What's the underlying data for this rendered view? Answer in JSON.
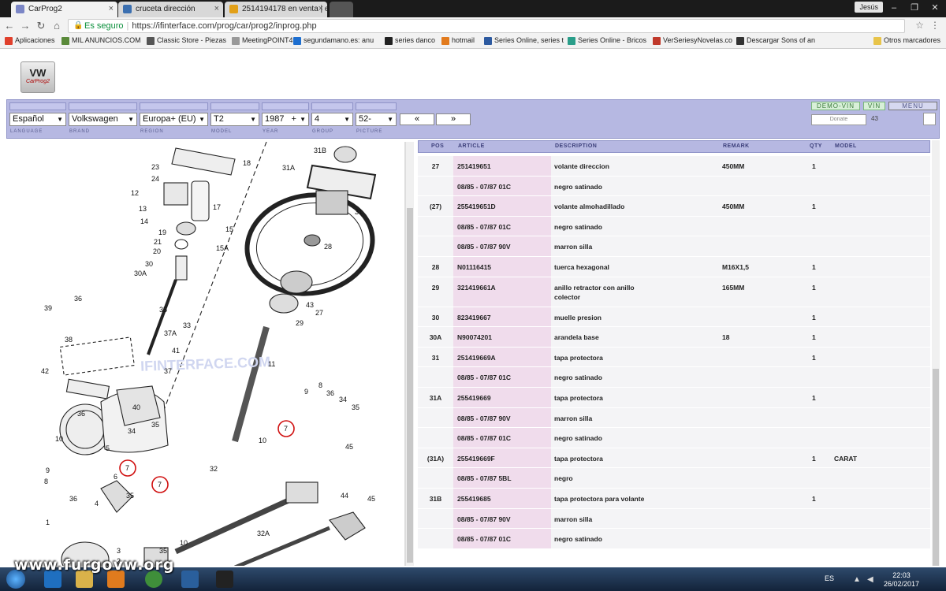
{
  "browser": {
    "tabs": [
      {
        "title": "CarProg2"
      },
      {
        "title": "cruceta dirección"
      },
      {
        "title": "2514194178 en venta | e"
      }
    ],
    "user": "Jesús",
    "secure_label": "Es seguro",
    "url": "https://ifinterface.com/prog/car/prog2/inprog.php",
    "bookmarks": [
      {
        "label": "Aplicaciones",
        "color": "#e0402c"
      },
      {
        "label": "MIL ANUNCIOS.COM",
        "color": "#5a8a3a"
      },
      {
        "label": "Classic Store - Piezas",
        "color": "#555"
      },
      {
        "label": "MeetingPOINT4u",
        "color": "#999"
      },
      {
        "label": "segundamano.es: anu",
        "color": "#1e6fd0"
      },
      {
        "label": "series danco",
        "color": "#222"
      },
      {
        "label": "hotmail",
        "color": "#e27b1e"
      },
      {
        "label": "Series Online, series t",
        "color": "#2d5aa0"
      },
      {
        "label": "Series Online - Bricos",
        "color": "#2a9e8a"
      },
      {
        "label": "VerSeriesyNovelas.co",
        "color": "#c0392b"
      },
      {
        "label": "Descargar Sons of an",
        "color": "#333"
      },
      {
        "label": "Otros marcadores",
        "color": "#e8c44a"
      }
    ]
  },
  "logo": {
    "brand": "VW",
    "sub": "CarProg2"
  },
  "selectors": {
    "language": "Español",
    "brand": "Volkswagen",
    "region": "Europa+ (EU)",
    "model": "T2",
    "year": "1987",
    "year_plus": "+",
    "group": "4",
    "picture": "52-",
    "prev": "«",
    "next": "»",
    "labels": [
      "LANGUAGE",
      "BRAND",
      "REGION",
      "MODEL",
      "YEAR",
      "GROUP",
      "PICTURE"
    ],
    "demo_vin": "DEMO-VIN",
    "vin": "VIN",
    "menu": "MENU",
    "donate": "Donate",
    "count": "43"
  },
  "diagram": {
    "watermark": "IFINTERFACE.COM",
    "callouts": [
      "23",
      "24",
      "12",
      "13",
      "14",
      "19",
      "21",
      "20",
      "30",
      "30A",
      "39",
      "36",
      "35",
      "38",
      "33",
      "37A",
      "41",
      "42",
      "37",
      "40",
      "36",
      "34",
      "35",
      "10",
      "9",
      "8",
      "36",
      "4",
      "35",
      "1",
      "3",
      "2",
      "35",
      "10",
      "17",
      "18",
      "15",
      "15A",
      "31B",
      "31A",
      "31",
      "28",
      "43",
      "27",
      "29",
      "11",
      "9",
      "8",
      "36",
      "34",
      "35",
      "10",
      "45",
      "32",
      "44",
      "45",
      "32A",
      "6",
      "5"
    ],
    "circled": [
      "7",
      "7",
      "7"
    ]
  },
  "table": {
    "headers": {
      "pos": "POS",
      "article": "ARTICLE",
      "description": "DESCRIPTION",
      "remark": "REMARK",
      "qty": "QTY",
      "model": "MODEL"
    },
    "rows": [
      {
        "pos": "27",
        "article": "251419651",
        "description": "volante direccion",
        "remark": "450MM",
        "qty": "1",
        "model": ""
      },
      {
        "pos": "",
        "article": "08/85 - 07/87  01C",
        "description": "negro satinado",
        "remark": "",
        "qty": "",
        "model": ""
      },
      {
        "pos": "(27)",
        "article": "255419651D",
        "description": "volante almohadillado",
        "remark": "450MM",
        "qty": "1",
        "model": ""
      },
      {
        "pos": "",
        "article": "08/85 - 07/87  01C",
        "description": "negro satinado",
        "remark": "",
        "qty": "",
        "model": ""
      },
      {
        "pos": "",
        "article": "08/85 - 07/87  90V",
        "description": "marron silla",
        "remark": "",
        "qty": "",
        "model": ""
      },
      {
        "pos": "28",
        "article": "N01116415",
        "description": "tuerca hexagonal",
        "remark": "M16X1,5",
        "qty": "1",
        "model": ""
      },
      {
        "pos": "29",
        "article": "321419661A",
        "description": "anillo retractor con anillo",
        "description2": "colector",
        "remark": "165MM",
        "qty": "1",
        "model": ""
      },
      {
        "pos": "30",
        "article": "823419667",
        "description": "muelle presion",
        "remark": "",
        "qty": "1",
        "model": ""
      },
      {
        "pos": "30A",
        "article": "N90074201",
        "description": "arandela base",
        "remark": "18",
        "qty": "1",
        "model": ""
      },
      {
        "pos": "31",
        "article": "251419669A",
        "description": "tapa protectora",
        "remark": "",
        "qty": "1",
        "model": ""
      },
      {
        "pos": "",
        "article": "08/85 - 07/87  01C",
        "description": "negro satinado",
        "remark": "",
        "qty": "",
        "model": ""
      },
      {
        "pos": "31A",
        "article": "255419669",
        "description": "tapa protectora",
        "remark": "",
        "qty": "1",
        "model": ""
      },
      {
        "pos": "",
        "article": "08/85 - 07/87  90V",
        "description": "marron silla",
        "remark": "",
        "qty": "",
        "model": ""
      },
      {
        "pos": "",
        "article": "08/85 - 07/87  01C",
        "description": "negro satinado",
        "remark": "",
        "qty": "",
        "model": ""
      },
      {
        "pos": "(31A)",
        "article": "255419669F",
        "description": "tapa protectora",
        "remark": "",
        "qty": "1",
        "model": "CARAT"
      },
      {
        "pos": "",
        "article": "08/85 - 07/87  5BL",
        "description": "negro",
        "remark": "",
        "qty": "",
        "model": ""
      },
      {
        "pos": "31B",
        "article": "255419685",
        "description": "tapa protectora para volante",
        "remark": "",
        "qty": "1",
        "model": ""
      },
      {
        "pos": "",
        "article": "08/85 - 07/87  90V",
        "description": "marron silla",
        "remark": "",
        "qty": "",
        "model": ""
      },
      {
        "pos": "",
        "article": "08/85 - 07/87  01C",
        "description": "negro satinado",
        "remark": "",
        "qty": "",
        "model": ""
      }
    ]
  },
  "taskbar": {
    "watermark": "www.furgovw.org",
    "lang": "ES",
    "time": "22:03",
    "date": "26/02/2017"
  }
}
